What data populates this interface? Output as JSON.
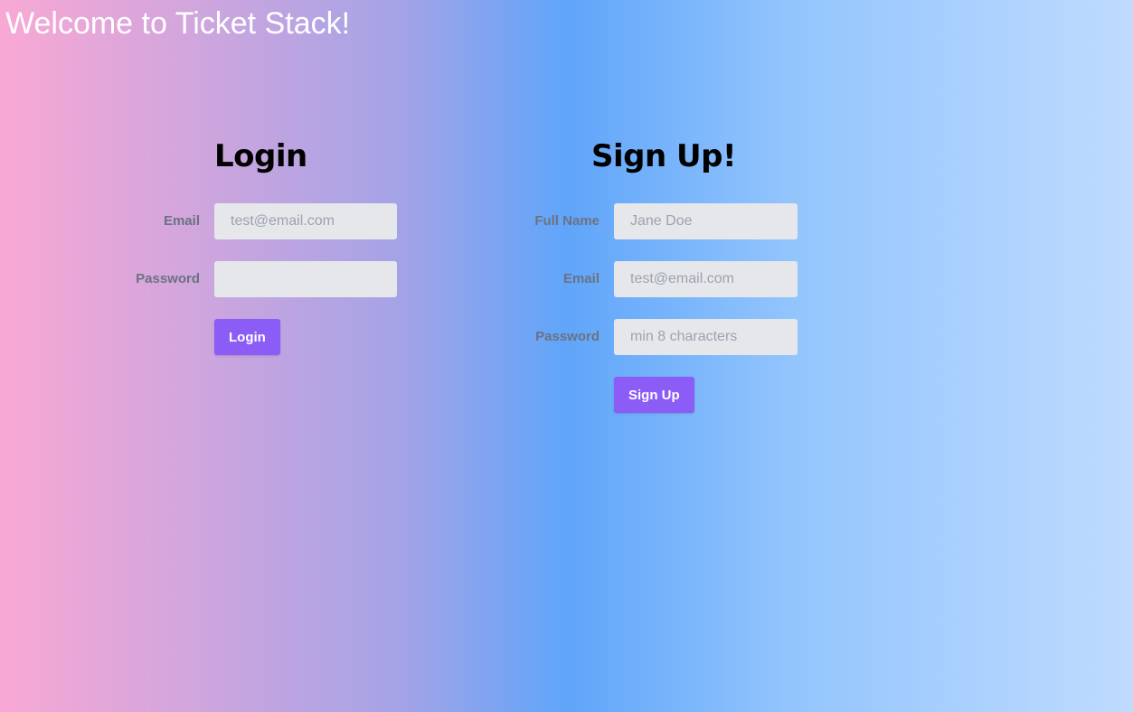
{
  "app": {
    "title": "Welcome to Ticket Stack!"
  },
  "login": {
    "heading": "Login",
    "email_label": "Email",
    "email_placeholder": "test@email.com",
    "email_value": "",
    "password_label": "Password",
    "password_placeholder": "",
    "password_value": "",
    "submit_label": "Login"
  },
  "signup": {
    "heading": "Sign Up!",
    "name_label": "Full Name",
    "name_placeholder": "Jane Doe",
    "name_value": "",
    "email_label": "Email",
    "email_placeholder": "test@email.com",
    "email_value": "",
    "password_label": "Password",
    "password_placeholder": "min 8 characters",
    "password_value": "",
    "submit_label": "Sign Up"
  },
  "colors": {
    "button": "#8b5cf6",
    "input_background": "#e5e7eb",
    "label_text": "#6b7280",
    "gradient_start": "#f9a8d4",
    "gradient_mid": "#60a5fa",
    "gradient_end": "#bfdbfe"
  }
}
